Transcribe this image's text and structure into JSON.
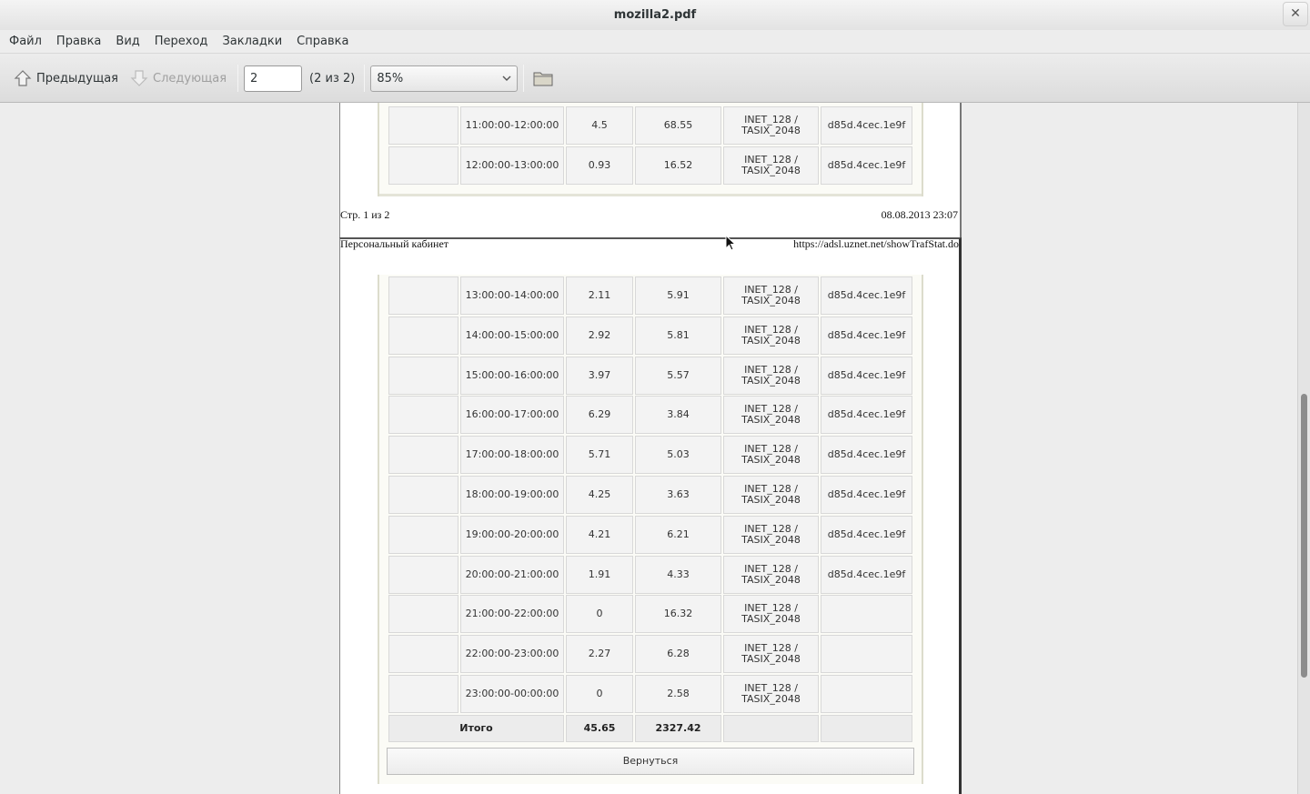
{
  "window": {
    "title": "mozilla2.pdf"
  },
  "menu": [
    "Файл",
    "Правка",
    "Вид",
    "Переход",
    "Закладки",
    "Справка"
  ],
  "toolbar": {
    "prev_label": "Предыдущая",
    "next_label": "Следующая",
    "page_value": "2",
    "page_count": "(2 из 2)",
    "zoom": "85%"
  },
  "page1": {
    "rows": [
      {
        "time": "11:00:00-12:00:00",
        "in": "4.5",
        "out": "68.55",
        "tariff": "INET_128 / TASIX_2048",
        "mac": "d85d.4cec.1e9f"
      },
      {
        "time": "12:00:00-13:00:00",
        "in": "0.93",
        "out": "16.52",
        "tariff": "INET_128 / TASIX_2048",
        "mac": "d85d.4cec.1e9f"
      }
    ],
    "footer_left": "Стр. 1 из 2",
    "footer_right": "08.08.2013 23:07"
  },
  "page2": {
    "header_left": "Персональный кабинет",
    "header_right": "https://adsl.uznet.net/showTrafStat.do",
    "rows": [
      {
        "time": "13:00:00-14:00:00",
        "in": "2.11",
        "out": "5.91",
        "tariff": "INET_128 / TASIX_2048",
        "mac": "d85d.4cec.1e9f"
      },
      {
        "time": "14:00:00-15:00:00",
        "in": "2.92",
        "out": "5.81",
        "tariff": "INET_128 / TASIX_2048",
        "mac": "d85d.4cec.1e9f"
      },
      {
        "time": "15:00:00-16:00:00",
        "in": "3.97",
        "out": "5.57",
        "tariff": "INET_128 / TASIX_2048",
        "mac": "d85d.4cec.1e9f"
      },
      {
        "time": "16:00:00-17:00:00",
        "in": "6.29",
        "out": "3.84",
        "tariff": "INET_128 / TASIX_2048",
        "mac": "d85d.4cec.1e9f"
      },
      {
        "time": "17:00:00-18:00:00",
        "in": "5.71",
        "out": "5.03",
        "tariff": "INET_128 / TASIX_2048",
        "mac": "d85d.4cec.1e9f"
      },
      {
        "time": "18:00:00-19:00:00",
        "in": "4.25",
        "out": "3.63",
        "tariff": "INET_128 / TASIX_2048",
        "mac": "d85d.4cec.1e9f"
      },
      {
        "time": "19:00:00-20:00:00",
        "in": "4.21",
        "out": "6.21",
        "tariff": "INET_128 / TASIX_2048",
        "mac": "d85d.4cec.1e9f"
      },
      {
        "time": "20:00:00-21:00:00",
        "in": "1.91",
        "out": "4.33",
        "tariff": "INET_128 / TASIX_2048",
        "mac": "d85d.4cec.1e9f"
      },
      {
        "time": "21:00:00-22:00:00",
        "in": "0",
        "out": "16.32",
        "tariff": "INET_128 / TASIX_2048",
        "mac": ""
      },
      {
        "time": "22:00:00-23:00:00",
        "in": "2.27",
        "out": "6.28",
        "tariff": "INET_128 / TASIX_2048",
        "mac": ""
      },
      {
        "time": "23:00:00-00:00:00",
        "in": "0",
        "out": "2.58",
        "tariff": "INET_128 / TASIX_2048",
        "mac": ""
      }
    ],
    "total": {
      "label": "Итого",
      "in": "45.65",
      "out": "2327.42"
    },
    "return_label": "Вернуться"
  }
}
